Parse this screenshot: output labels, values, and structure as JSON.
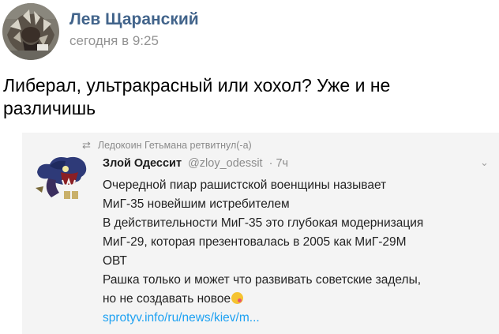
{
  "post": {
    "author": "Лев Щаранский",
    "time": "сегодня в 9:25",
    "text_lines": [
      "Либерал, ультракрасный или хохол? Уже и не",
      "различишь"
    ]
  },
  "tweet": {
    "retweet_label": "Ледокоин Гетьмана ретвитнул(-а)",
    "name": "Злой Одессит",
    "handle": "@zloy_odessit",
    "time": "· 7ч",
    "lines": [
      "Очередной пиар рашистской военщины называет",
      "МиГ-35 новейшим истребителем",
      "В действительности МиГ-35 это глубокая модернизация",
      "МиГ-29, которая презентовалась в 2005 как МиГ-29М",
      "ОВТ",
      "Рашка только и может что развивать советские заделы,",
      "но не создавать новое"
    ],
    "link": "sprotyv.info/ru/news/kiev/m..."
  },
  "icons": {
    "retweet": "retweet-icon",
    "more": "chevron-down-icon",
    "emoji": "tongue-emoji-icon"
  },
  "colors": {
    "author": "#42648b",
    "link": "#1da1f2",
    "muted": "#939393"
  }
}
